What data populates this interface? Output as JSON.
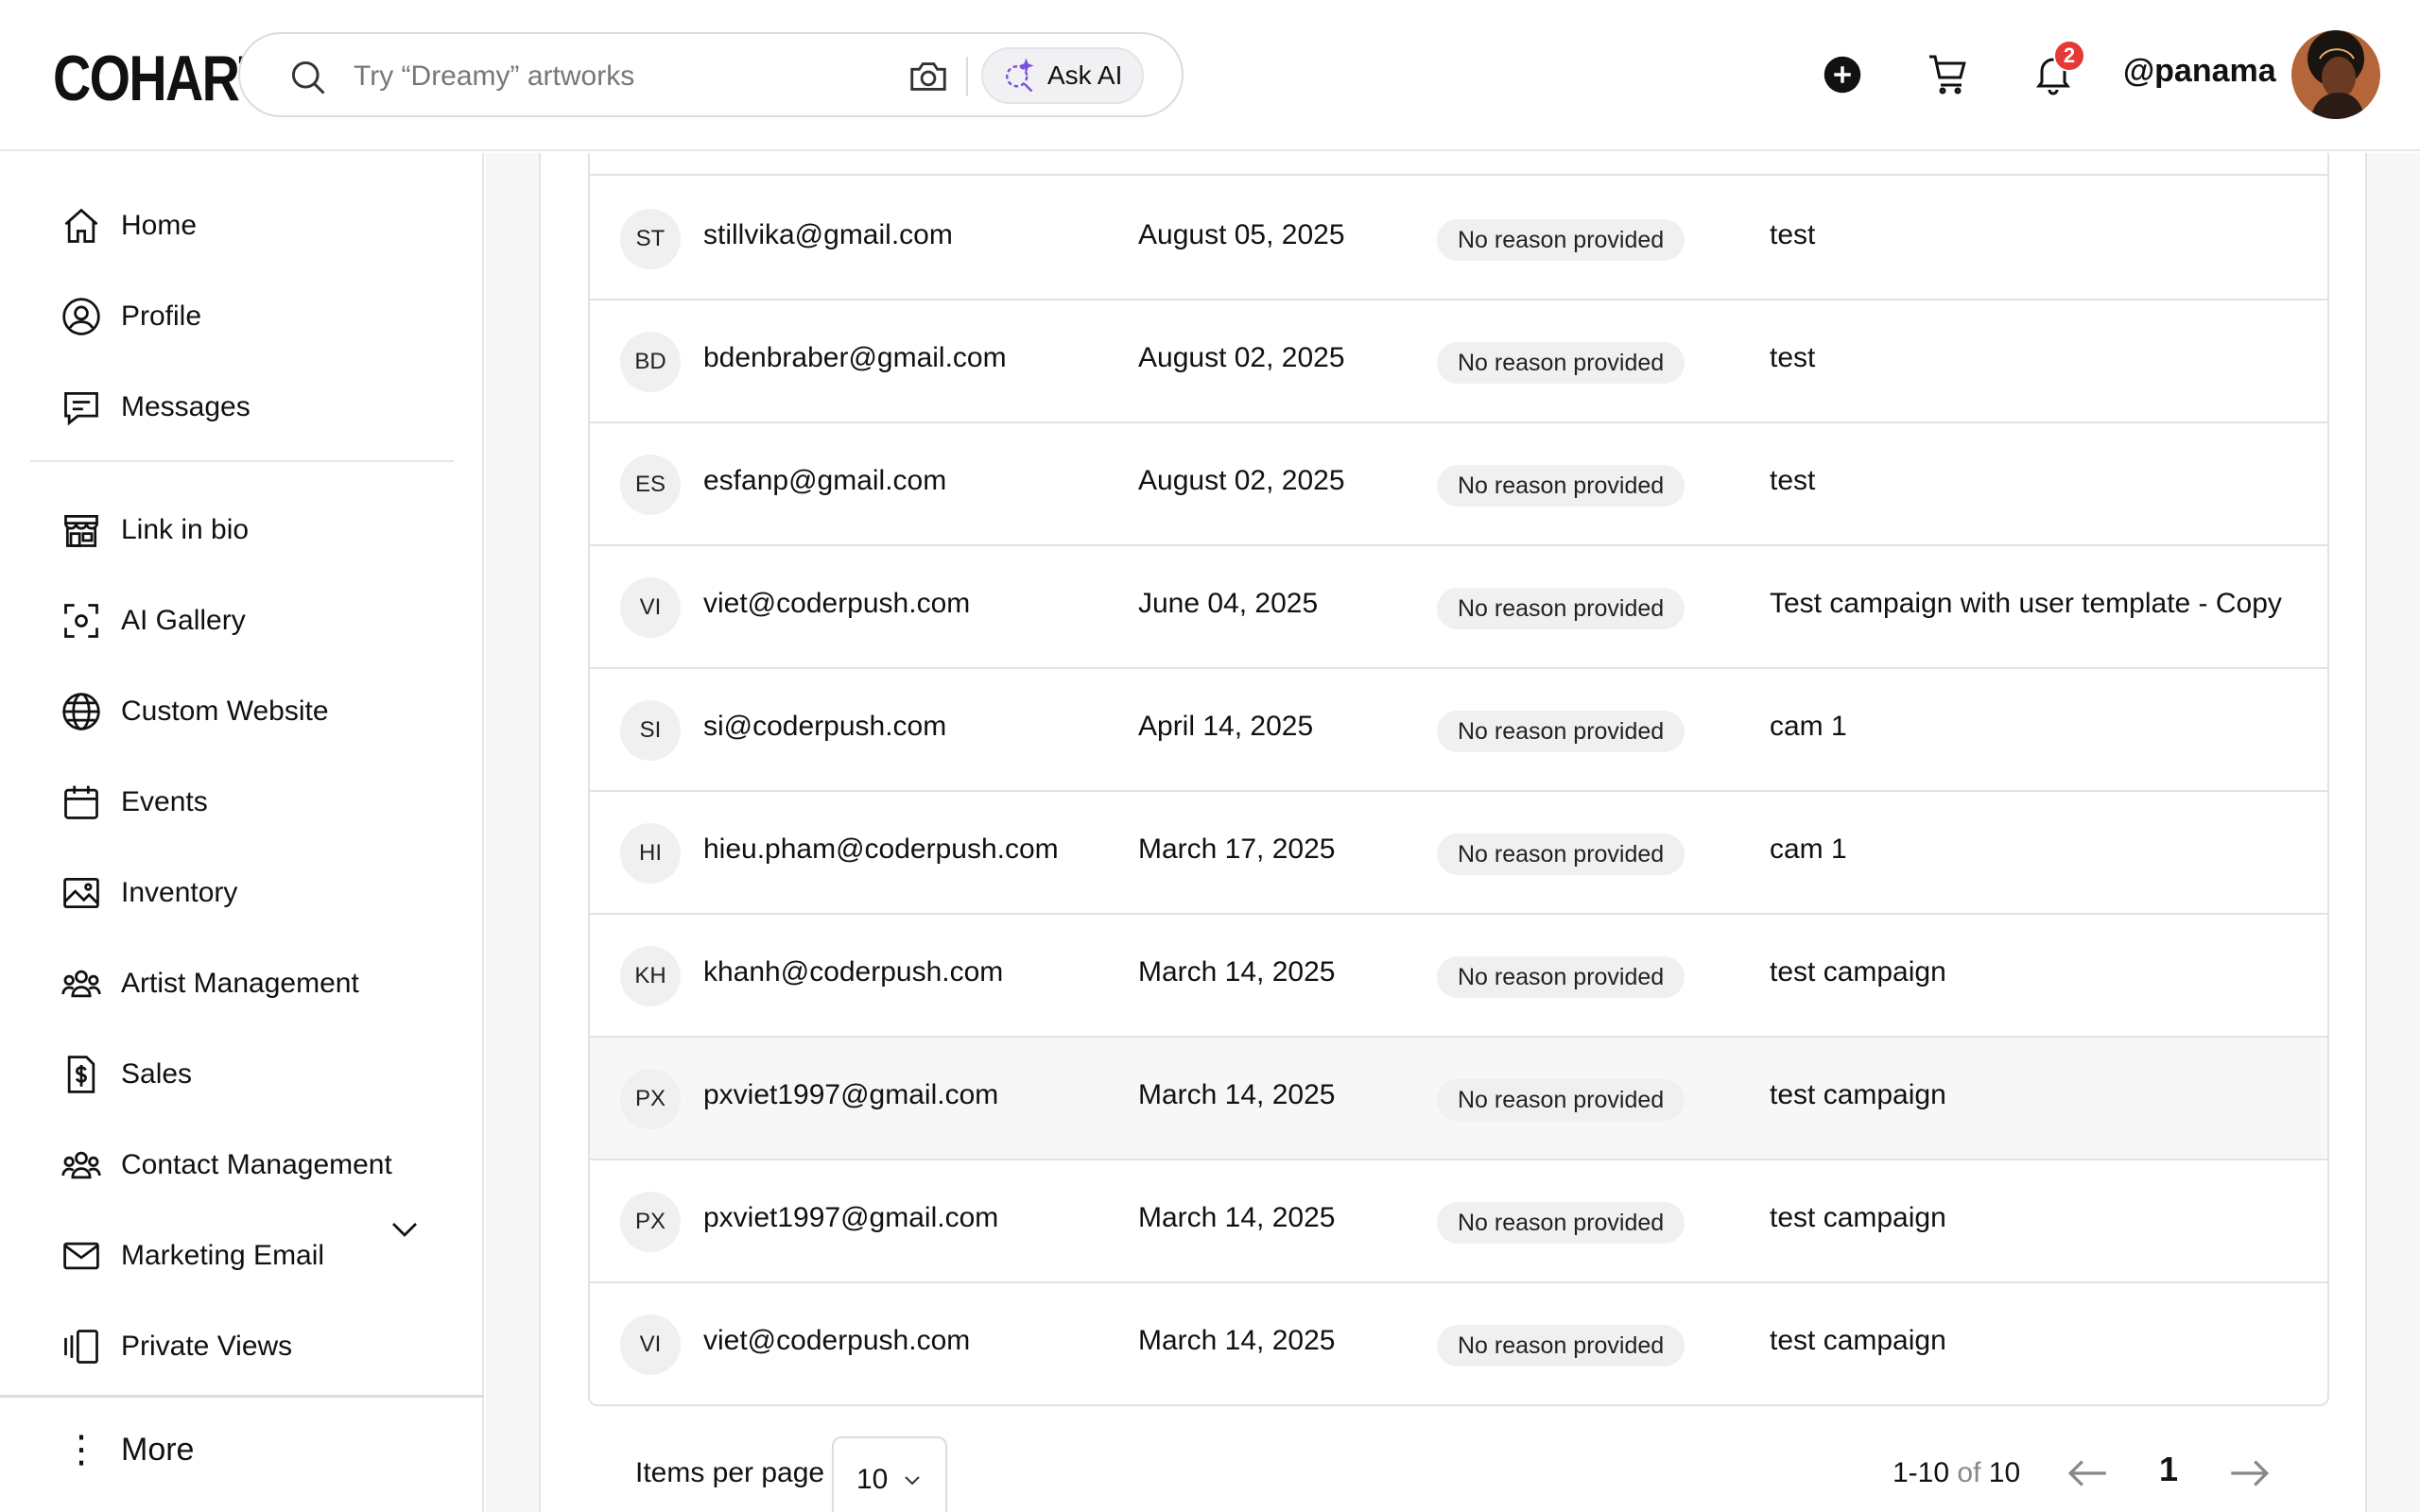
{
  "app": {
    "logo": "COHART"
  },
  "search": {
    "placeholder": "Try “Dreamy” artworks",
    "ask_ai_label": "Ask AI"
  },
  "header": {
    "notification_count": "2",
    "username": "@panama"
  },
  "sidebar": {
    "items": [
      {
        "label": "Home",
        "icon": "home-icon"
      },
      {
        "label": "Profile",
        "icon": "user-circle-icon"
      },
      {
        "label": "Messages",
        "icon": "message-icon"
      },
      {
        "label": "Link in bio",
        "icon": "store-icon"
      },
      {
        "label": "AI Gallery",
        "icon": "scan-icon"
      },
      {
        "label": "Custom Website",
        "icon": "globe-icon"
      },
      {
        "label": "Events",
        "icon": "calendar-icon"
      },
      {
        "label": "Inventory",
        "icon": "image-icon"
      },
      {
        "label": "Artist Management",
        "icon": "users-icon"
      },
      {
        "label": "Sales",
        "icon": "dollar-file-icon"
      },
      {
        "label": "Contact Management",
        "icon": "users-icon"
      },
      {
        "label": "Marketing Email",
        "icon": "mail-icon"
      },
      {
        "label": "Private Views",
        "icon": "gallery-view-icon"
      }
    ],
    "more_label": "More"
  },
  "table": {
    "rows": [
      {
        "initials": "ST",
        "email": "stillvika@gmail.com",
        "date": "August 05, 2025",
        "reason": "No reason provided",
        "campaign": "test"
      },
      {
        "initials": "BD",
        "email": "bdenbraber@gmail.com",
        "date": "August 02, 2025",
        "reason": "No reason provided",
        "campaign": "test"
      },
      {
        "initials": "ES",
        "email": "esfanp@gmail.com",
        "date": "August 02, 2025",
        "reason": "No reason provided",
        "campaign": "test"
      },
      {
        "initials": "VI",
        "email": "viet@coderpush.com",
        "date": "June 04, 2025",
        "reason": "No reason provided",
        "campaign": "Test campaign with user template - Copy"
      },
      {
        "initials": "SI",
        "email": "si@coderpush.com",
        "date": "April 14, 2025",
        "reason": "No reason provided",
        "campaign": "cam 1"
      },
      {
        "initials": "HI",
        "email": "hieu.pham@coderpush.com",
        "date": "March 17, 2025",
        "reason": "No reason provided",
        "campaign": "cam 1"
      },
      {
        "initials": "KH",
        "email": "khanh@coderpush.com",
        "date": "March 14, 2025",
        "reason": "No reason provided",
        "campaign": "test campaign"
      },
      {
        "initials": "PX",
        "email": "pxviet1997@gmail.com",
        "date": "March 14, 2025",
        "reason": "No reason provided",
        "campaign": "test campaign"
      },
      {
        "initials": "PX",
        "email": "pxviet1997@gmail.com",
        "date": "March 14, 2025",
        "reason": "No reason provided",
        "campaign": "test campaign"
      },
      {
        "initials": "VI",
        "email": "viet@coderpush.com",
        "date": "March 14, 2025",
        "reason": "No reason provided",
        "campaign": "test campaign"
      }
    ]
  },
  "pagination": {
    "items_per_page_label": "Items per page",
    "items_per_page_value": "10",
    "range": "1-10",
    "of_label": "of",
    "total": "10",
    "current_page": "1"
  }
}
